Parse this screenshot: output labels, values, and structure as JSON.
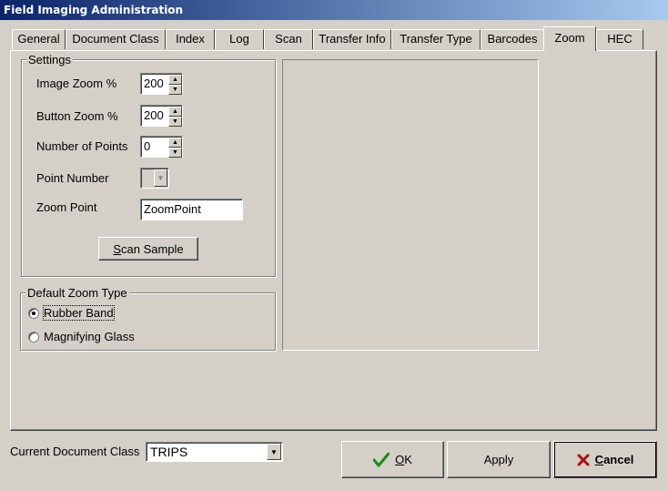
{
  "window": {
    "title": "Field Imaging Administration"
  },
  "tabs": [
    {
      "label": "General"
    },
    {
      "label": "Document Class"
    },
    {
      "label": "Index"
    },
    {
      "label": "Log"
    },
    {
      "label": "Scan"
    },
    {
      "label": "Transfer Info"
    },
    {
      "label": "Transfer Type"
    },
    {
      "label": "Barcodes"
    },
    {
      "label": "Zoom",
      "active": true
    },
    {
      "label": "HEC"
    }
  ],
  "settings": {
    "legend": "Settings",
    "image_zoom": {
      "label": "Image Zoom %",
      "value": "200"
    },
    "button_zoom": {
      "label": "Button Zoom %",
      "value": "200"
    },
    "number_of_points": {
      "label": "Number of Points",
      "value": "0"
    },
    "point_number": {
      "label": "Point Number",
      "value": ""
    },
    "zoom_point": {
      "label": "Zoom Point",
      "value": "ZoomPoint"
    },
    "scan_sample": {
      "accel": "S",
      "rest": "can Sample"
    }
  },
  "default_zoom_type": {
    "legend": "Default Zoom Type",
    "options": [
      {
        "label": "Rubber Band",
        "selected": true
      },
      {
        "label": "Magnifying Glass",
        "selected": false
      }
    ]
  },
  "footer": {
    "current_class_label": "Current Document Class",
    "current_class_value": "TRIPS",
    "ok": {
      "accel": "O",
      "rest": "K"
    },
    "apply": "Apply",
    "cancel": {
      "accel": "C",
      "rest": "ancel"
    }
  },
  "icons": {
    "ok": "checkmark-icon",
    "cancel": "x-icon",
    "spin_up": "spin-up-arrow",
    "spin_down": "spin-down-arrow",
    "dropdown": "chevron-down-icon"
  },
  "colors": {
    "titlebar_start": "#0a246a",
    "titlebar_end": "#a6caf0",
    "face": "#d4d0c8",
    "ok_check": "#1a8a1a",
    "cancel_x": "#b01010"
  }
}
